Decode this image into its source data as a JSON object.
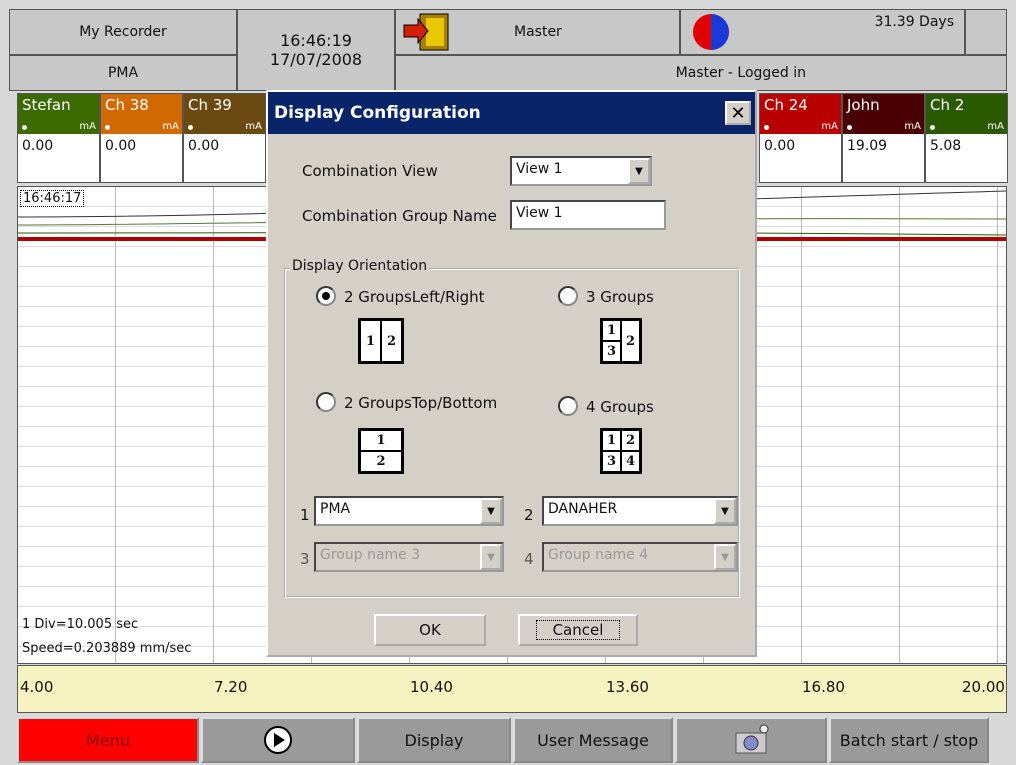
{
  "header": {
    "recorder_name": "My Recorder",
    "group": "PMA",
    "time": "16:46:19",
    "date": "17/07/2008",
    "user": "Master",
    "login_status": "Master - Logged in",
    "days": "31.39 Days"
  },
  "channels": [
    {
      "name": "Stefan",
      "unit": "mA",
      "value": "0.00",
      "color": "#3a6a00"
    },
    {
      "name": "Ch 38",
      "unit": "mA",
      "value": "0.00",
      "color": "#d06a00"
    },
    {
      "name": "Ch 39",
      "unit": "mA",
      "value": "0.00",
      "color": "#6a4a10"
    },
    {
      "name": "Ch 24",
      "unit": "mA",
      "value": "0.00",
      "color": "#b80000"
    },
    {
      "name": "John",
      "unit": "mA",
      "value": "19.09",
      "color": "#4a0000"
    },
    {
      "name": "Ch 2",
      "unit": "mA",
      "value": "5.08",
      "color": "#2a5a00"
    }
  ],
  "chart": {
    "cursor_time": "16:46:17",
    "div_label": "1 Div=10.005 sec",
    "speed_label": "Speed=0.203889 mm/sec"
  },
  "scale": {
    "ticks": [
      "4.00",
      "7.20",
      "10.40",
      "13.60",
      "16.80",
      "20.00"
    ]
  },
  "softkeys": {
    "menu": "Menu",
    "display": "Display",
    "user_message": "User Message",
    "batch": "Batch start / stop"
  },
  "dialog": {
    "title": "Display Configuration",
    "close": "✕",
    "combination_view_label": "Combination View",
    "combination_view_value": "View 1",
    "group_name_label": "Combination Group Name",
    "group_name_value": "View 1",
    "orientation_legend": "Display Orientation",
    "options": {
      "lr": "2 GroupsLeft/Right",
      "three": "3 Groups",
      "tb": "2 GroupsTop/Bottom",
      "four": "4 Groups"
    },
    "selected": "lr",
    "slot_numbers": [
      "1",
      "2",
      "3",
      "4"
    ],
    "group1": "PMA",
    "group2": "DANAHER",
    "group3": "Group name 3",
    "group4": "Group name 4",
    "ok": "OK",
    "cancel": "Cancel"
  },
  "colors": {
    "title_bar": "#0a246a",
    "menu_key": "#ff0000",
    "scale_bg": "#f7f3c0",
    "trace": "#b00000"
  }
}
